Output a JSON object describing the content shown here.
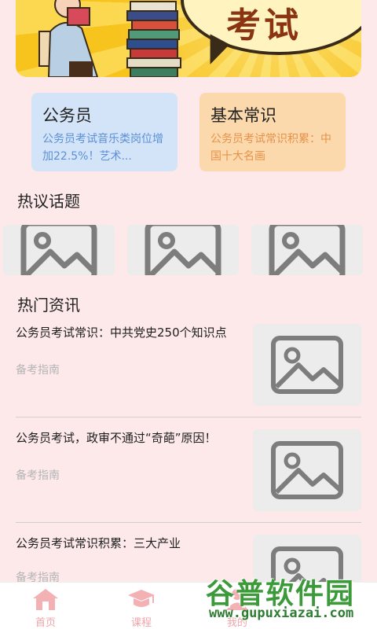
{
  "banner": {
    "bubble_text": "考试",
    "colors": {
      "background": "#f7c31d",
      "bubble": "#fff3c0",
      "text": "#8a3412"
    }
  },
  "cards": [
    {
      "title": "公务员",
      "desc": "公务员考试音乐类岗位增加22.5%！艺术...",
      "color": "#d4e4f8",
      "accent": "#5b8fd6"
    },
    {
      "title": "基本常识",
      "desc": "公务员考试常识积累：中国十大名画",
      "color": "#fcd9ac",
      "accent": "#e6924a"
    }
  ],
  "sections": {
    "topics_title": "热议话题",
    "news_title": "热门资讯"
  },
  "topics": [
    {
      "icon": "image-placeholder-icon"
    },
    {
      "icon": "image-placeholder-icon"
    },
    {
      "icon": "image-placeholder-icon"
    }
  ],
  "news": [
    {
      "title": "公务员考试常识：中共党史250个知识点",
      "source": "备考指南",
      "thumb_icon": "image-placeholder-icon"
    },
    {
      "title": "公务员考试，政审不通过“奇葩”原因！",
      "source": "备考指南",
      "thumb_icon": "image-placeholder-icon"
    },
    {
      "title": "公务员考试常识积累：三大产业",
      "source": "备考指南",
      "thumb_icon": "image-placeholder-icon"
    }
  ],
  "nav": {
    "items": [
      {
        "label": "首页",
        "icon": "home-icon"
      },
      {
        "label": "课程",
        "icon": "graduation-cap-icon"
      },
      {
        "label": "我的",
        "icon": "user-icon"
      }
    ],
    "color": "#f0a4a8"
  },
  "watermark": {
    "name": "谷普软件园",
    "url": "www.gupuxiazai.com"
  }
}
